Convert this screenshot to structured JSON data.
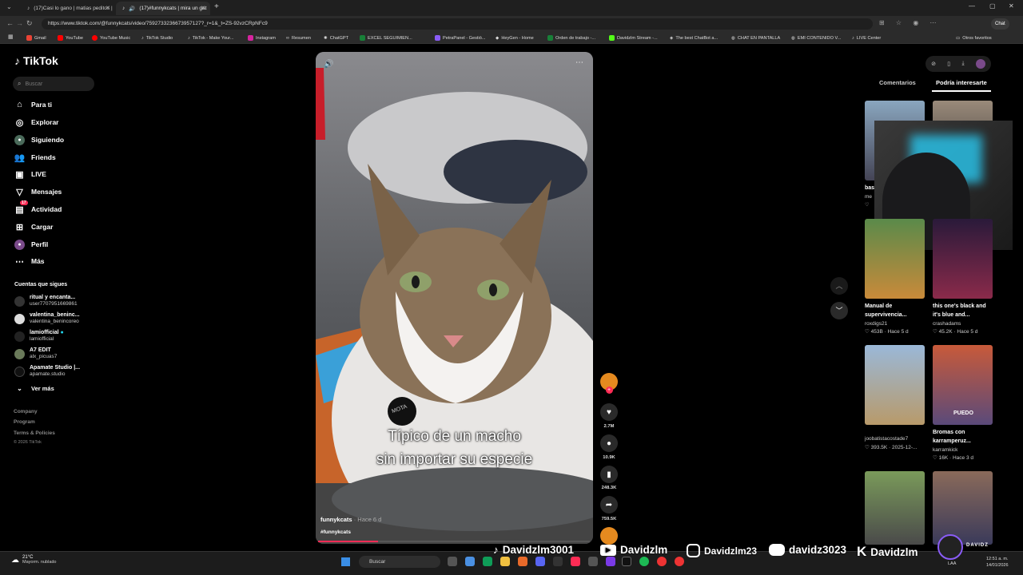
{
  "browser": {
    "tabs": [
      {
        "title": "(17)Casi lo gano | matias peditos |"
      },
      {
        "title": "(17)#funnykcats | mira un gat"
      }
    ],
    "url": "https://www.tiktok.com/@funnykcats/video/7592733236673957127?_r=1&_t=ZS-92vzCRpNFc9",
    "profile_chat": "Chat",
    "bookmarks": [
      "Gmail",
      "YouTube",
      "YouTube Music",
      "TikTok Studio",
      "TikTok - Make Your...",
      "Instagram",
      "Resumen",
      "ChatGPT",
      "EXCEL SEGUIMIEN...",
      "PetraPanel - Gestió...",
      "HeyGen - Home",
      "Orden de trabajo -...",
      "Davidzlm Stream -...",
      "The best ChatBot a...",
      "CHAT EN PANTALLA",
      "EMI CONTENIDO V...",
      "LIVE Center"
    ],
    "other_bookmarks": "Otros favoritos"
  },
  "sidebar": {
    "logo": "TikTok",
    "search_placeholder": "Buscar",
    "nav": [
      "Para ti",
      "Explorar",
      "Siguiendo",
      "Friends",
      "LIVE",
      "Mensajes",
      "Actividad",
      "Cargar",
      "Perfil",
      "Más"
    ],
    "activity_badge": "17",
    "following_title": "Cuentas que sigues",
    "accounts": [
      {
        "name": "ritual y encanta...",
        "handle": "user7707951669861"
      },
      {
        "name": "valentina_beninc...",
        "handle": "valentina_benincoreo"
      },
      {
        "name": "lamiofficial",
        "handle": "lamiofficial"
      },
      {
        "name": "A7 EDIT",
        "handle": "alx_picuas7"
      },
      {
        "name": "Apamate Studio |...",
        "handle": "apamate.studio"
      }
    ],
    "see_more": "Ver más",
    "footer": [
      "Company",
      "Program",
      "Terms & Policies",
      "© 2026 TikTok"
    ]
  },
  "video": {
    "caption_line1": "Típico de un macho",
    "caption_line2": "sin importar su especie",
    "author": "funnykcats",
    "time": "· Hace 6 d",
    "hashtag": "#funnykcats",
    "tag_text": "MOTA",
    "progress": 0.22
  },
  "actions": {
    "likes": "2.7M",
    "comments": "10.9K",
    "saves": "248.3K",
    "shares": "759.5K"
  },
  "right_panel": {
    "tab_comments": "Comentarios",
    "tab_interest": "Podría interesarte",
    "cards": [
      {
        "title": "bas",
        "user": "me",
        "meta": ""
      },
      {
        "title": "",
        "user": "",
        "meta": ""
      },
      {
        "title": "Manual de supervivencia...",
        "user": "roxdigs21",
        "meta": "♡ 453B · Hace 5 d"
      },
      {
        "title": "this one's black and it's blue and...",
        "user": "crashadams",
        "meta": "♡ 45.2K · Hace 5 d"
      },
      {
        "title": "",
        "user": "joobatistacostade7",
        "meta": "♡ 393.5K · 2025-12-..."
      },
      {
        "title": "Bromas con karramperuz...",
        "user": "karramkick",
        "meta": "♡ 16K · Hace 3 d"
      }
    ],
    "thumb_text": "PUEDO"
  },
  "stream_overlay": {
    "socials": [
      "Davidzlm3001",
      "Davidzlm",
      "Davidzlm23",
      "davidz3023",
      "Davidzlm"
    ],
    "badge": "DAVIDZ"
  },
  "taskbar": {
    "weather_temp": "21°C",
    "weather_desc": "Mayorm. nublado",
    "search": "Buscar",
    "lang": "LAA",
    "time": "12:51 a. m.",
    "date": "14/01/2026"
  }
}
